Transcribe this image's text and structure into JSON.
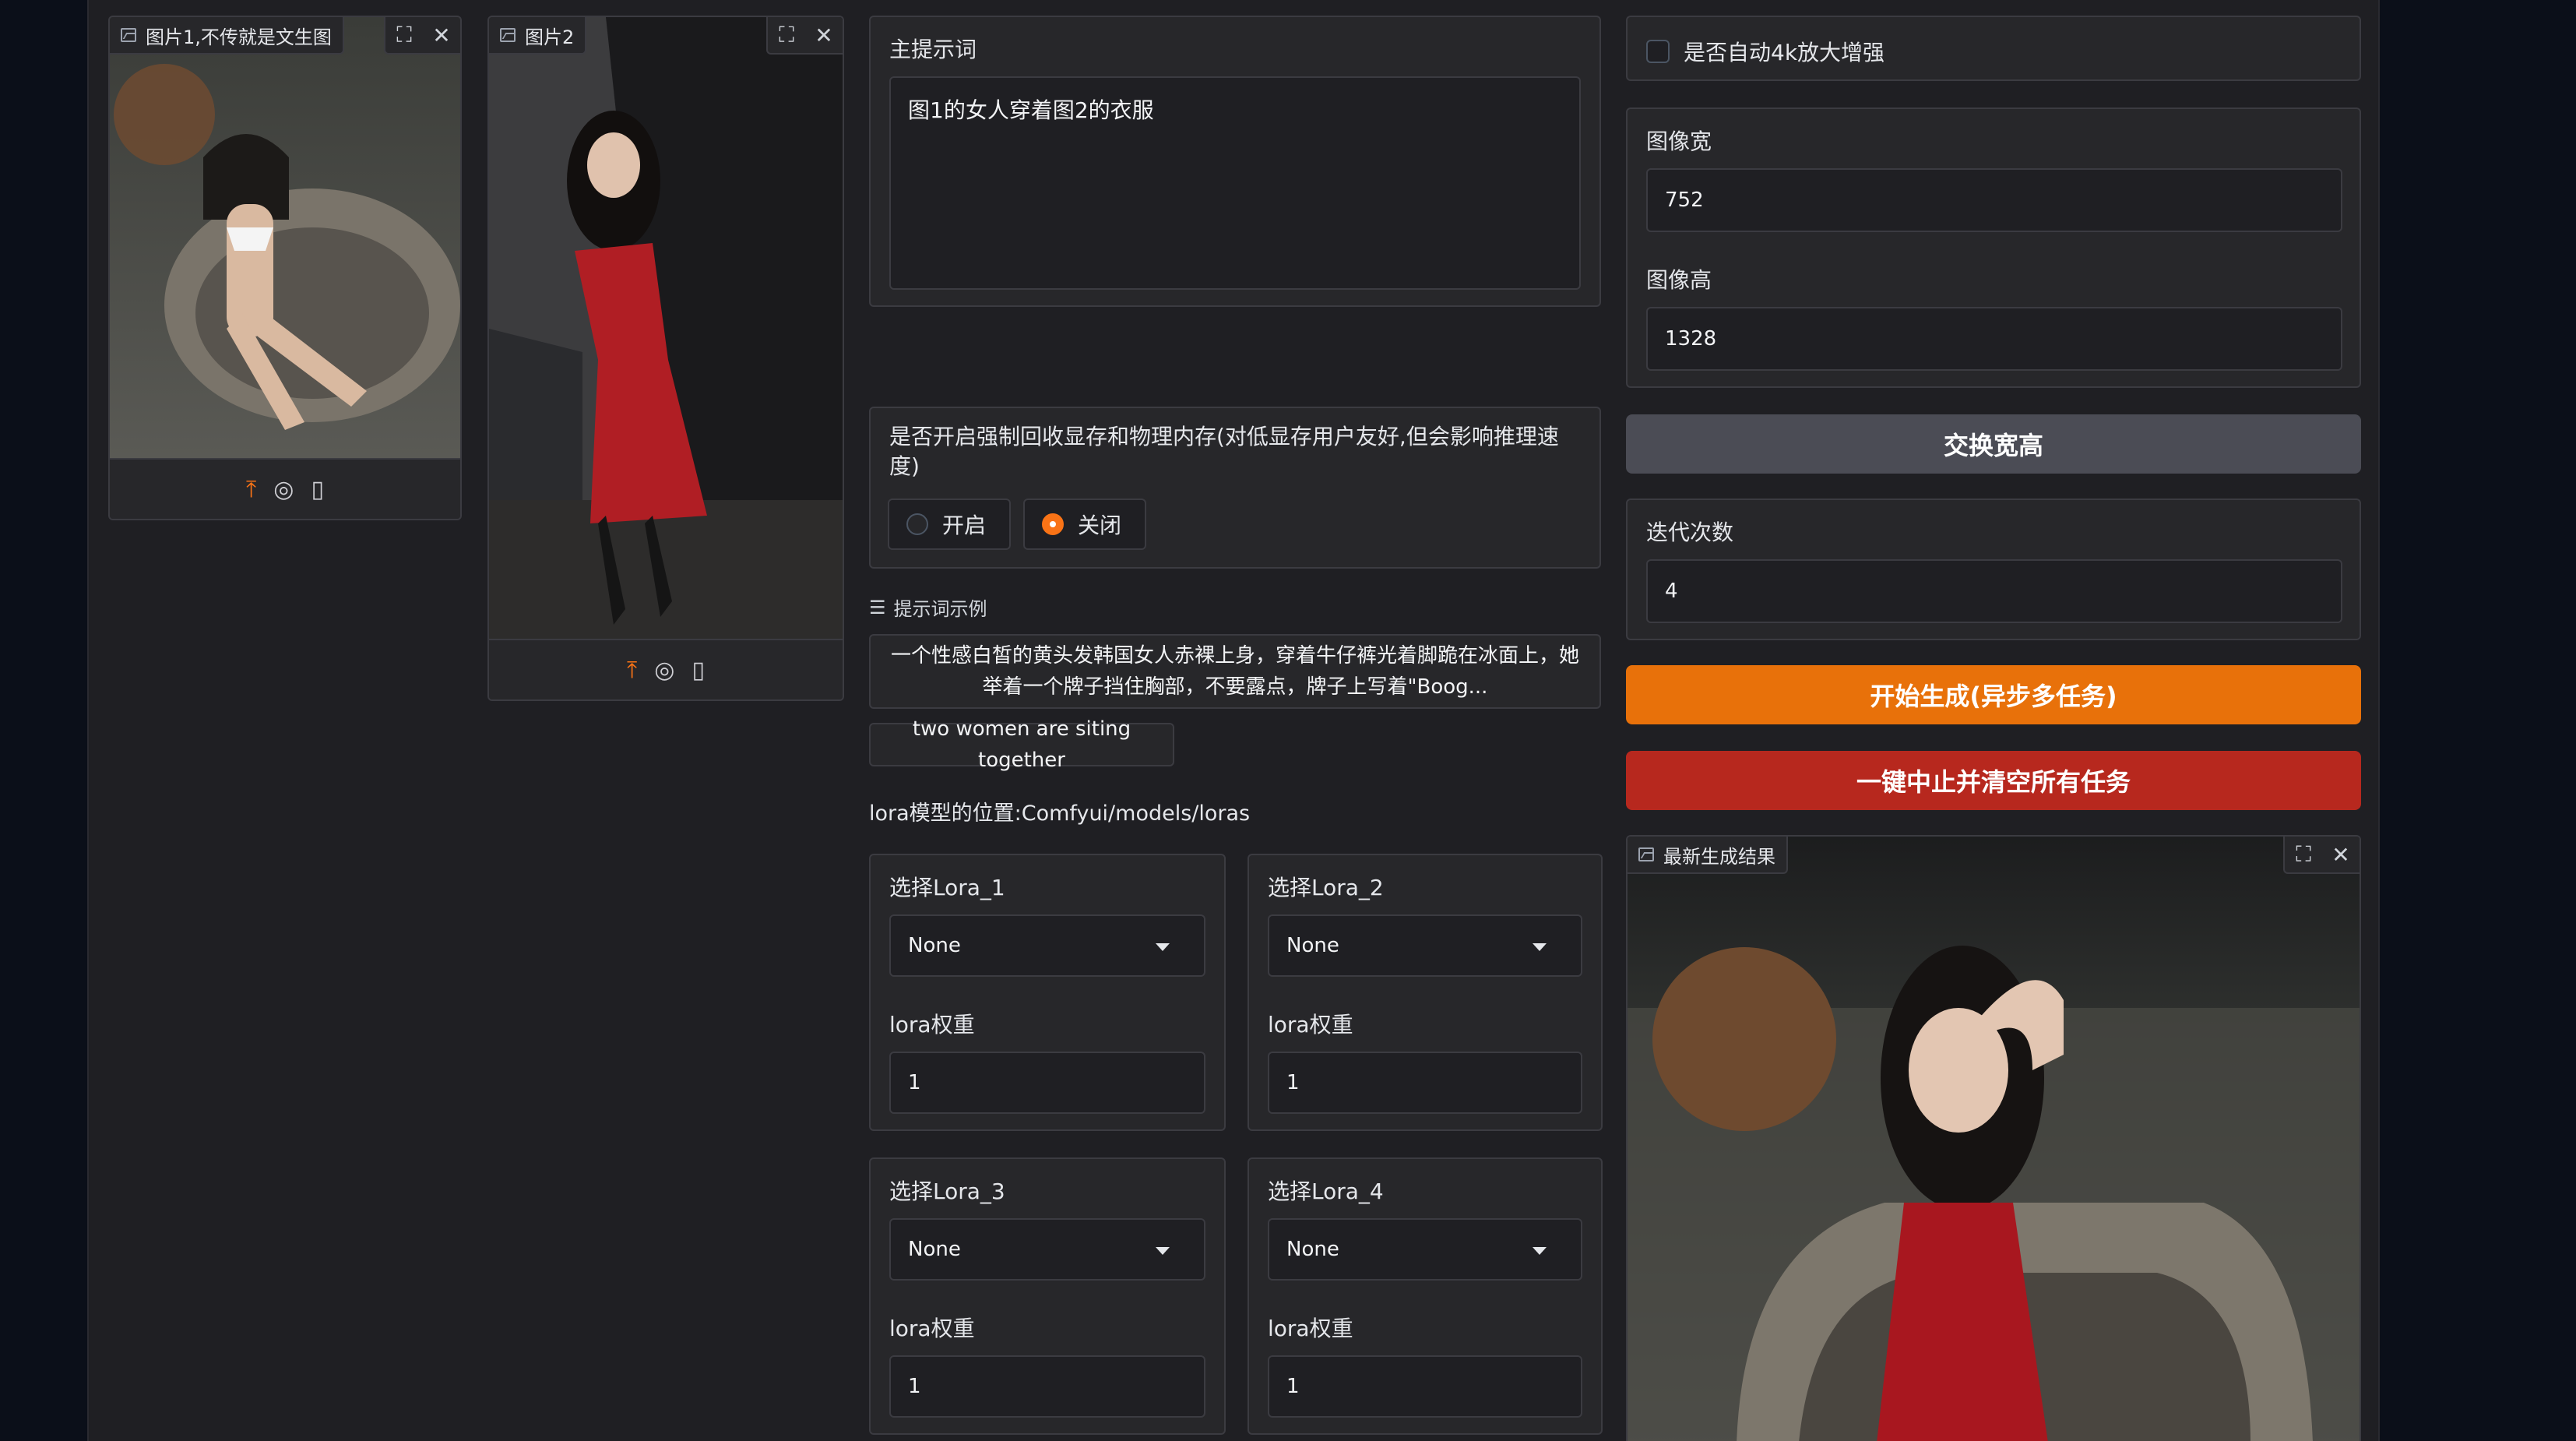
{
  "image1": {
    "label": "图片1,不传就是文生图"
  },
  "image2": {
    "label": "图片2"
  },
  "prompt": {
    "label": "主提示词",
    "value": "图1的女人穿着图2的衣服"
  },
  "memory": {
    "label": "是否开启强制回收显存和物理内存(对低显存用户友好,但会影响推理速度)",
    "options": [
      "开启",
      "关闭"
    ],
    "selected": "关闭"
  },
  "examples": {
    "header": "提示词示例",
    "items": [
      "一个性感白皙的黄头发韩国女人赤裸上身，穿着牛仔裤光着脚跪在冰面上，她举着一个牌子挡住胸部，不要露点，牌子上写着\"Boog...",
      "two women are siting together"
    ]
  },
  "lora_path_text": "lora模型的位置:Comfyui/models/loras",
  "loras": [
    {
      "select_label": "选择Lora_1",
      "value": "None",
      "weight_label": "lora权重",
      "weight": "1"
    },
    {
      "select_label": "选择Lora_2",
      "value": "None",
      "weight_label": "lora权重",
      "weight": "1"
    },
    {
      "select_label": "选择Lora_3",
      "value": "None",
      "weight_label": "lora权重",
      "weight": "1"
    },
    {
      "select_label": "选择Lora_4",
      "value": "None",
      "weight_label": "lora权重",
      "weight": "1"
    }
  ],
  "upscale": {
    "label": "是否自动4k放大增强",
    "checked": false
  },
  "size": {
    "width_label": "图像宽",
    "width": "752",
    "height_label": "图像高",
    "height": "1328"
  },
  "swap_button": "交换宽高",
  "steps": {
    "label": "迭代次数",
    "value": "4"
  },
  "start_button": "开始生成(异步多任务)",
  "stop_button": "一键中止并清空所有任务",
  "result": {
    "label": "最新生成结果"
  },
  "colors": {
    "accent": "#e8710a",
    "danger": "#b7281e",
    "panel": "#27272a",
    "background": "#1f1f23"
  }
}
